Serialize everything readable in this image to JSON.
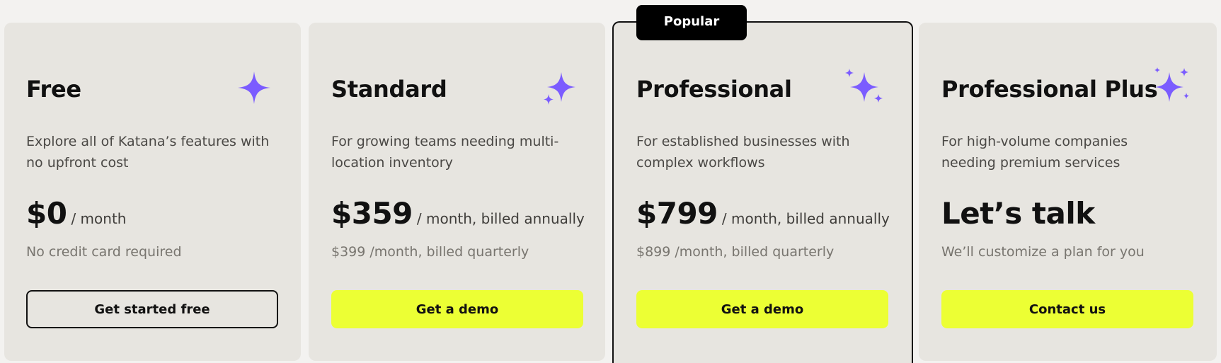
{
  "colors": {
    "accent_button": "#ecff34",
    "sparkle": "#7b5cff",
    "card_bg": "#e7e5e0",
    "page_bg": "#f3f2f0"
  },
  "badge": "Popular",
  "plans": [
    {
      "title": "Free",
      "icon": "sparkle-single-icon",
      "description": "Explore all of Katana’s features with no upfront cost",
      "price": "$0",
      "period": "/ month",
      "note": "No credit card required",
      "cta": "Get started free"
    },
    {
      "title": "Standard",
      "icon": "sparkle-double-icon",
      "description": "For growing teams needing multi-location inventory",
      "price": "$359",
      "period": "/ month, billed annually",
      "note": "$399 /month, billed quarterly",
      "cta": "Get a demo"
    },
    {
      "title": "Professional",
      "icon": "sparkle-triple-icon",
      "description": "For established businesses with complex workflows",
      "price": "$799",
      "period": "/ month, billed annually",
      "note": "$899 /month, billed quarterly",
      "cta": "Get a demo"
    },
    {
      "title": "Professional Plus",
      "icon": "sparkle-cluster-icon",
      "description": "For high-volume companies needing premium services",
      "price": "Let’s talk",
      "period": "",
      "note": "We’ll customize a plan for you",
      "cta": "Contact us"
    }
  ]
}
